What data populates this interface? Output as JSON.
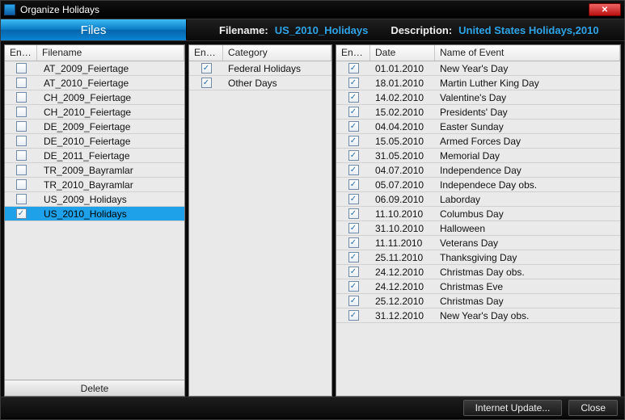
{
  "window": {
    "title": "Organize Holidays"
  },
  "header": {
    "files_tab": "Files",
    "filename_label": "Filename:",
    "filename_value": "US_2010_Holidays",
    "description_label": "Description:",
    "description_value": "United States Holidays,2010"
  },
  "files_panel": {
    "columns": {
      "enabled": "Enab...",
      "filename": "Filename"
    },
    "rows": [
      {
        "enabled": false,
        "filename": "AT_2009_Feiertage",
        "selected": false
      },
      {
        "enabled": false,
        "filename": "AT_2010_Feiertage",
        "selected": false
      },
      {
        "enabled": false,
        "filename": "CH_2009_Feiertage",
        "selected": false
      },
      {
        "enabled": false,
        "filename": "CH_2010_Feiertage",
        "selected": false
      },
      {
        "enabled": false,
        "filename": "DE_2009_Feiertage",
        "selected": false
      },
      {
        "enabled": false,
        "filename": "DE_2010_Feiertage",
        "selected": false
      },
      {
        "enabled": false,
        "filename": "DE_2011_Feiertage",
        "selected": false
      },
      {
        "enabled": false,
        "filename": "TR_2009_Bayramlar",
        "selected": false
      },
      {
        "enabled": false,
        "filename": "TR_2010_Bayramlar",
        "selected": false
      },
      {
        "enabled": false,
        "filename": "US_2009_Holidays",
        "selected": false
      },
      {
        "enabled": true,
        "filename": "US_2010_Holidays",
        "selected": true
      }
    ],
    "delete_label": "Delete"
  },
  "categories_panel": {
    "columns": {
      "enabled": "Enab...",
      "category": "Category"
    },
    "rows": [
      {
        "enabled": true,
        "category": "Federal Holidays"
      },
      {
        "enabled": true,
        "category": "Other Days"
      }
    ]
  },
  "events_panel": {
    "columns": {
      "enabled": "Enab...",
      "date": "Date",
      "name": "Name of Event"
    },
    "rows": [
      {
        "enabled": true,
        "date": "01.01.2010",
        "name": "New Year's Day"
      },
      {
        "enabled": true,
        "date": "18.01.2010",
        "name": "Martin Luther King Day"
      },
      {
        "enabled": true,
        "date": "14.02.2010",
        "name": "Valentine's Day"
      },
      {
        "enabled": true,
        "date": "15.02.2010",
        "name": "Presidents' Day"
      },
      {
        "enabled": true,
        "date": "04.04.2010",
        "name": "Easter Sunday"
      },
      {
        "enabled": true,
        "date": "15.05.2010",
        "name": "Armed Forces Day"
      },
      {
        "enabled": true,
        "date": "31.05.2010",
        "name": "Memorial Day"
      },
      {
        "enabled": true,
        "date": "04.07.2010",
        "name": "Independence Day"
      },
      {
        "enabled": true,
        "date": "05.07.2010",
        "name": "Independece Day obs."
      },
      {
        "enabled": true,
        "date": "06.09.2010",
        "name": "Laborday"
      },
      {
        "enabled": true,
        "date": "11.10.2010",
        "name": "Columbus Day"
      },
      {
        "enabled": true,
        "date": "31.10.2010",
        "name": "Halloween"
      },
      {
        "enabled": true,
        "date": "11.11.2010",
        "name": "Veterans Day"
      },
      {
        "enabled": true,
        "date": "25.11.2010",
        "name": "Thanksgiving Day"
      },
      {
        "enabled": true,
        "date": "24.12.2010",
        "name": "Christmas Day obs."
      },
      {
        "enabled": true,
        "date": "24.12.2010",
        "name": "Christmas Eve"
      },
      {
        "enabled": true,
        "date": "25.12.2010",
        "name": "Christmas Day"
      },
      {
        "enabled": true,
        "date": "31.12.2010",
        "name": "New Year's Day obs."
      }
    ]
  },
  "footer": {
    "internet_update": "Internet Update...",
    "close": "Close"
  }
}
